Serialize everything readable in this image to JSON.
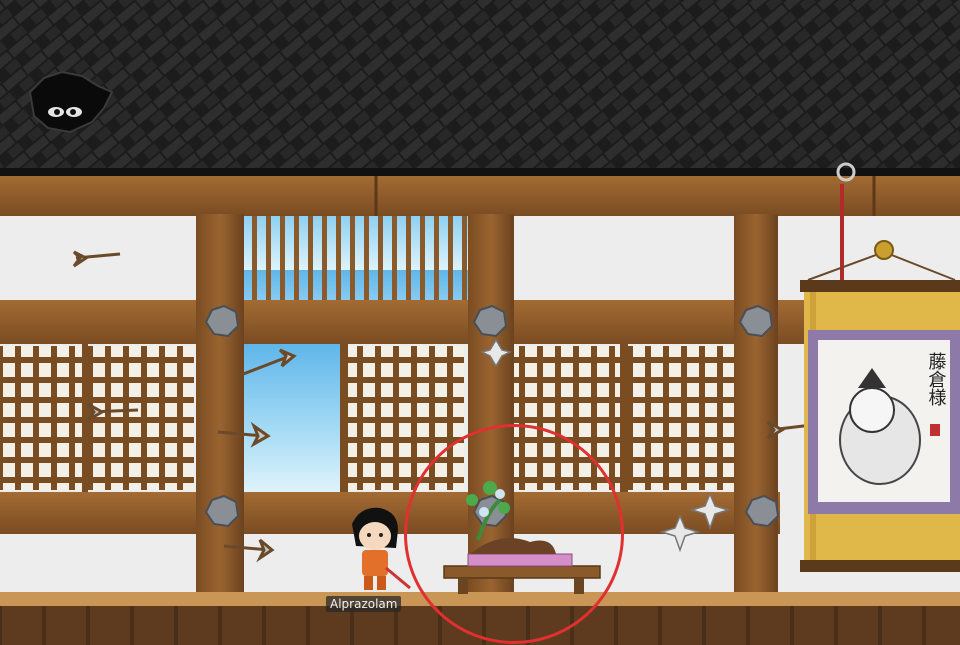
{
  "player": {
    "name": "Alprazolam"
  },
  "scroll": {
    "calligraphy": "藤倉様",
    "seal": "印"
  },
  "colors": {
    "roof": "#1e1e1e",
    "beam": "#8a5a2a",
    "beam_dark": "#6b4420",
    "plaster": "#eeeeee",
    "shoji_cell": "#f4f1ea",
    "sky": "#7fc8ef",
    "scroll_gold": "#e0b84a",
    "scroll_purple": "#8d7aa8",
    "highlight": "#e03030"
  }
}
